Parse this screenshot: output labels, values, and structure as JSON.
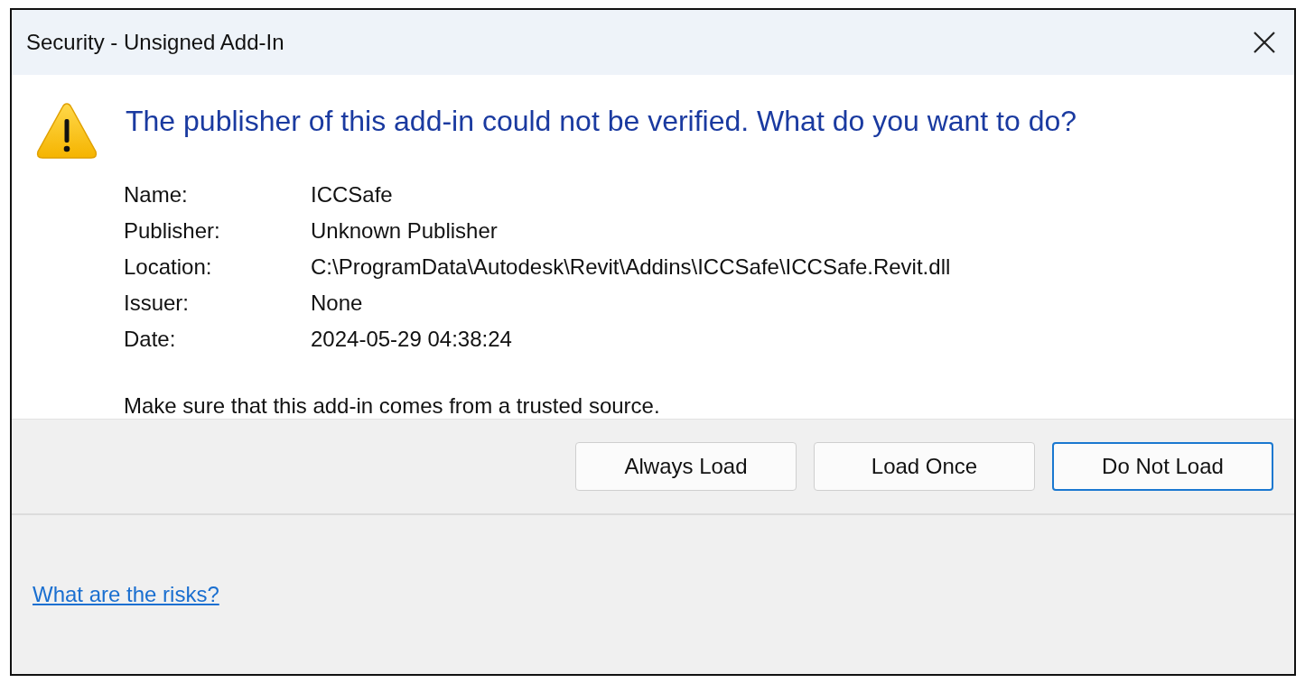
{
  "window": {
    "title": "Security - Unsigned Add-In"
  },
  "heading": "The publisher of this add-in could not be verified. What do you want to do?",
  "details": [
    {
      "label": "Name:",
      "value": "ICCSafe"
    },
    {
      "label": "Publisher:",
      "value": "Unknown Publisher"
    },
    {
      "label": "Location:",
      "value": "C:\\ProgramData\\Autodesk\\Revit\\Addins\\ICCSafe\\ICCSafe.Revit.dll"
    },
    {
      "label": "Issuer:",
      "value": "None"
    },
    {
      "label": "Date:",
      "value": "2024-05-29 04:38:24"
    }
  ],
  "advice": "Make sure that this add-in comes from a trusted source.",
  "buttons": [
    {
      "label": "Always Load",
      "default": false
    },
    {
      "label": "Load Once",
      "default": false
    },
    {
      "label": "Do Not Load",
      "default": true
    }
  ],
  "footer_link": "What are the risks?"
}
